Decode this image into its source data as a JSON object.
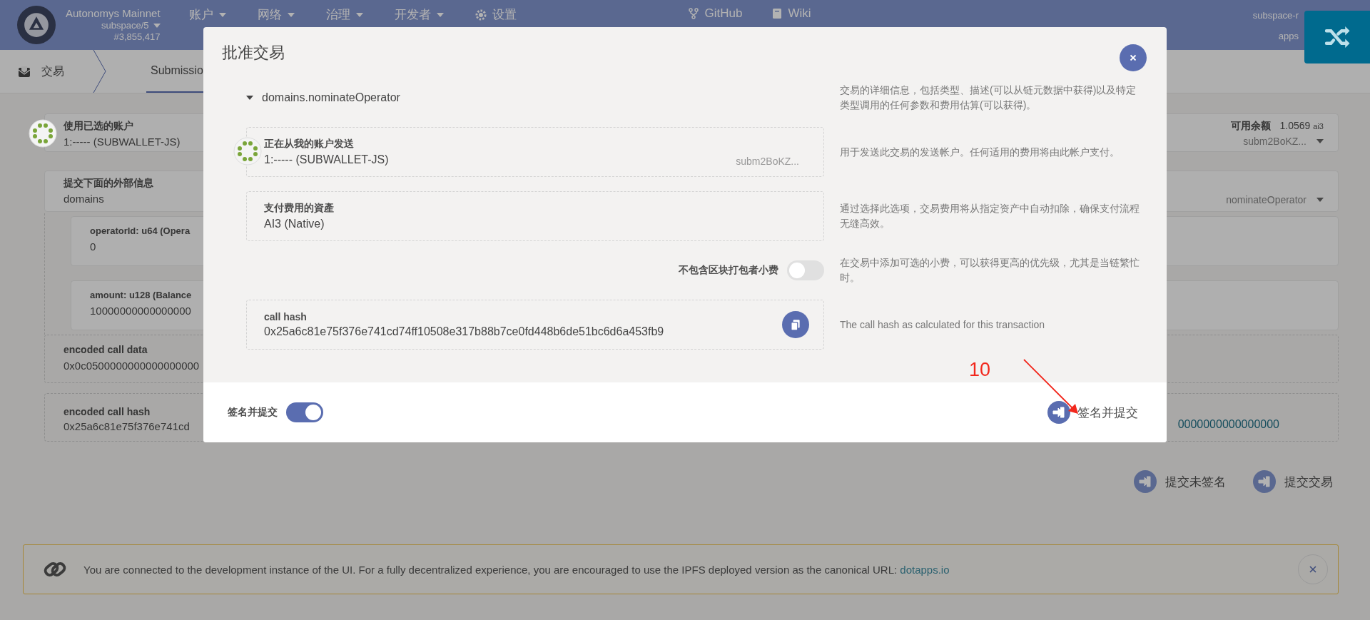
{
  "header": {
    "network_name": "Autonomys Mainnet",
    "chain": "subspace/5",
    "block": "#3,855,417",
    "menu": [
      {
        "label": "账户",
        "kind": "dropdown"
      },
      {
        "label": "网络",
        "kind": "dropdown"
      },
      {
        "label": "治理",
        "kind": "dropdown"
      },
      {
        "label": "开发者",
        "kind": "dropdown"
      },
      {
        "label": "设置",
        "kind": "settings"
      }
    ],
    "links": [
      "GitHub",
      "Wiki"
    ],
    "node_name": "subspace-r",
    "app_label": "apps"
  },
  "tabs": {
    "section": "交易",
    "items": [
      {
        "label": "Submissio",
        "selected": true
      }
    ]
  },
  "form": {
    "account": {
      "label": "使用已选的账户",
      "value": "1:----- (SUBWALLET-JS)",
      "balance_label": "可用余额",
      "balance": "1.0569",
      "unit": "ai3",
      "address": "subm2BoKZ..."
    },
    "extrinsic": {
      "label": "提交下面的外部信息",
      "section": "domains",
      "method": "nominateOperator"
    },
    "params": [
      {
        "label": "operatorId: u64 (Opera",
        "value": "0"
      },
      {
        "label": "amount: u128 (Balance",
        "value": "10000000000000000"
      }
    ],
    "encoded_call_data": {
      "label": "encoded call data",
      "value": "0x0c0500000000000000000"
    },
    "encoded_call_hash": {
      "label": "encoded call hash",
      "value": "0x25a6c81e75f376e741cd",
      "link": "0000000000000000"
    }
  },
  "buttons": [
    "提交未签名",
    "提交交易"
  ],
  "banner": {
    "text": "You are connected to the development instance of the UI. For a fully decentralized experience, you are encouraged to use the IPFS deployed version as the canonical URL: ",
    "link": "dotapps.io"
  },
  "modal": {
    "title": "批准交易",
    "summary": "domains.nominateOperator",
    "expanded": true,
    "summary_help": "交易的详细信息，包括类型、描述(可以从链元数据中获得)以及特定类型调用的任何参数和费用估算(可以获得)。",
    "rows": [
      {
        "kind": "account",
        "label": "正在从我的账户发送",
        "value": "1:----- (SUBWALLET-JS)",
        "address": "subm2BoKZ...",
        "help": "用于发送此交易的发送帐户。任何适用的费用将由此帐户支付。"
      },
      {
        "kind": "field",
        "label": "支付费用的資產",
        "value": "AI3 (Native)",
        "help": "通过选择此选项，交易费用将从指定资产中自动扣除，确保支付流程无缝高效。"
      },
      {
        "kind": "toggle",
        "label": "不包含区块打包者小费",
        "on": false,
        "help": "在交易中添加可选的小费，可以获得更高的优先级，尤其是当链繁忙时。"
      },
      {
        "kind": "hash",
        "label": "call hash",
        "value": "0x25a6c81e75f376e741cd74ff10508e317b88b7ce0fd448b6de51bc6d6a453fb9",
        "help": "The call hash as calculated for this transaction"
      }
    ],
    "footer_toggle": {
      "label": "签名并提交",
      "on": true
    },
    "submit": "签名并提交"
  },
  "annotation": {
    "text": "10"
  }
}
